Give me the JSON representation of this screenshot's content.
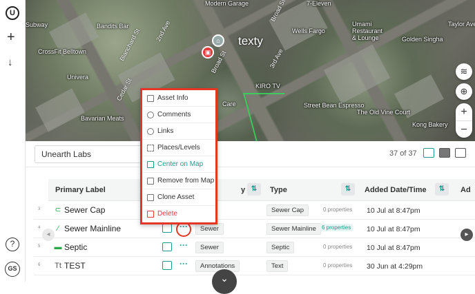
{
  "rail": {
    "logo": "U",
    "add_label": "+",
    "download_label": "↓",
    "help_label": "?",
    "avatar_initials": "GS"
  },
  "map": {
    "labels": [
      "Subway",
      "Bandits Bar",
      "Modern Garage",
      "7-Eleven",
      "Wells Fargo",
      "CrossFit Belltown",
      "Umami Restaurant & Lounge",
      "Golden Singha",
      "Univera",
      "KIRO TV",
      "Street Bean Espresso",
      "Bavarian Meats",
      "Care",
      "The Old Vine Court",
      "Kong Bakery",
      "Taylor Ave"
    ],
    "streets": [
      "2nd Ave",
      "3rd Ave",
      "Broad St",
      "Blanchard St",
      "Broad St",
      "Cedar St"
    ],
    "watermark": "texty"
  },
  "panel": {
    "project": "Unearth Labs",
    "count": "37 of 37",
    "columns": {
      "primary_label": "Primary Label",
      "category": "y",
      "type": "Type",
      "added": "Added Date/Time",
      "added_by": "Ad"
    },
    "rows": [
      {
        "idx": "3",
        "name": "Sewer Cap",
        "category": "",
        "type": "Sewer Cap",
        "props": "0 properties",
        "date": "10 Jul at 8:47pm"
      },
      {
        "idx": "4",
        "name": "Sewer Mainline",
        "category": "Sewer",
        "type": "Sewer Mainline",
        "props": "6 properties",
        "date": "10 Jul at 8:47pm"
      },
      {
        "idx": "5",
        "name": "Septic",
        "category": "Sewer",
        "type": "Septic",
        "props": "0 properties",
        "date": "10 Jul at 8:47pm"
      },
      {
        "idx": "6",
        "name": "TEST",
        "category": "Annotations",
        "type": "Text",
        "props": "0 properties",
        "date": "30 Jun at 4:29pm"
      }
    ]
  },
  "menu": {
    "items": [
      {
        "label": "Asset Info"
      },
      {
        "label": "Comments"
      },
      {
        "label": "Links"
      },
      {
        "label": "Places/Levels"
      },
      {
        "label": "Center on Map"
      },
      {
        "label": "Remove from Map"
      },
      {
        "label": "Clone Asset"
      },
      {
        "label": "Delete"
      }
    ]
  },
  "colors": {
    "accent": "#1a9a8f",
    "danger": "#e23b3b",
    "highlight": "#e53526"
  }
}
